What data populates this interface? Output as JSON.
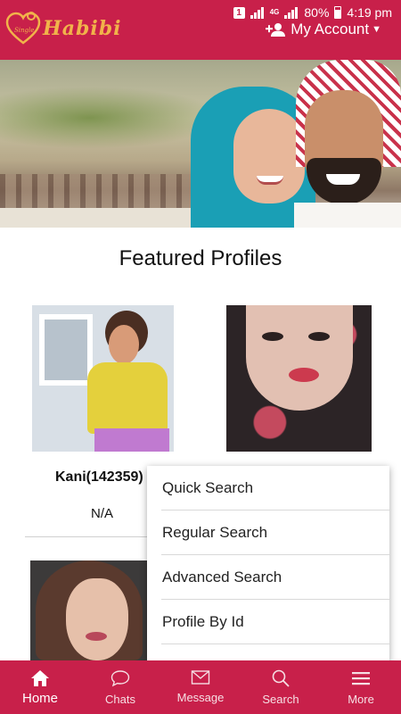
{
  "status_bar": {
    "sim": "1",
    "network": "4G",
    "battery": "80%",
    "time": "4:19 pm"
  },
  "app": {
    "logo_text": "Habibi",
    "logo_badge": "Single",
    "account_label": "My Account"
  },
  "main": {
    "section_title": "Featured Profiles",
    "profiles": [
      {
        "name": "Kani(142359)",
        "meta": "N/A"
      }
    ]
  },
  "dropdown": {
    "items": [
      {
        "label": "Quick Search"
      },
      {
        "label": "Regular Search"
      },
      {
        "label": "Advanced Search"
      },
      {
        "label": "Profile By Id"
      }
    ]
  },
  "bottom_nav": {
    "items": [
      {
        "label": "Home",
        "icon": "home-icon",
        "active": true
      },
      {
        "label": "Chats",
        "icon": "chat-bubble-icon"
      },
      {
        "label": "Message",
        "icon": "envelope-icon"
      },
      {
        "label": "Search",
        "icon": "search-icon"
      },
      {
        "label": "More",
        "icon": "menu-icon"
      }
    ]
  },
  "colors": {
    "brand": "#c8204a",
    "logo_gold": "#f1b34a"
  }
}
